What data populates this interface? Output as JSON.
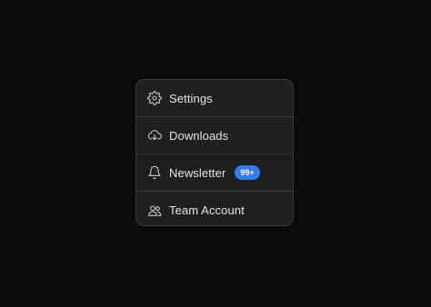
{
  "menu": {
    "items": [
      {
        "label": "Settings",
        "icon": "gear-icon"
      },
      {
        "label": "Downloads",
        "icon": "cloud-download-icon"
      },
      {
        "label": "Newsletter",
        "icon": "bell-icon",
        "badge": "99+"
      },
      {
        "label": "Team Account",
        "icon": "users-icon"
      }
    ]
  },
  "colors": {
    "background": "#0b0b0b",
    "panel": "#1f1f20",
    "border": "#3a3a3c",
    "text": "#e6e6e6",
    "badge": "#2f7df0"
  }
}
